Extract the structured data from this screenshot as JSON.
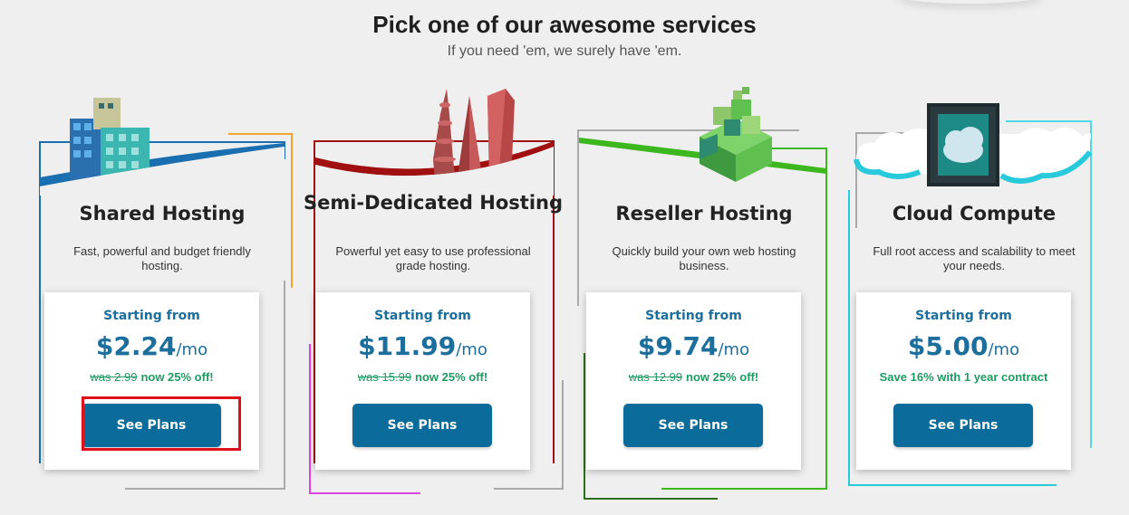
{
  "page": {
    "heading": "Pick one of our awesome services",
    "subheading": "If you need 'em, we surely have 'em."
  },
  "colors": {
    "accent": "#0b6b9a",
    "price": "#1c6e9c",
    "discount": "#1e9b62",
    "highlight": "#e0101a"
  },
  "services": [
    {
      "title": "Shared Hosting",
      "description": "Fast, powerful and budget friendly hosting.",
      "starting_label": "Starting from",
      "price": "$2.24",
      "per": "/mo",
      "was": "was 2.99",
      "deal": "now 25% off!",
      "button": "See Plans",
      "icon": "office-buildings-icon",
      "frame_color": "#1a6fb0"
    },
    {
      "title": "Semi-Dedicated Hosting",
      "description": "Powerful yet easy to use professional grade hosting.",
      "starting_label": "Starting from",
      "price": "$11.99",
      "per": "/mo",
      "was": "was 15.99",
      "deal": "now 25% off!",
      "button": "See Plans",
      "icon": "towers-icon",
      "frame_color": "#b01a1a"
    },
    {
      "title": "Reseller Hosting",
      "description": "Quickly build your own web hosting business.",
      "starting_label": "Starting from",
      "price": "$9.74",
      "per": "/mo",
      "was": "was 12.99",
      "deal": "now 25% off!",
      "button": "See Plans",
      "icon": "green-blocks-icon",
      "frame_color": "#3cb81e"
    },
    {
      "title": "Cloud Compute",
      "description": "Full root access and scalability to meet your needs.",
      "starting_label": "Starting from",
      "price": "$5.00",
      "per": "/mo",
      "was": "",
      "deal": "Save 16% with 1 year contract",
      "button": "See Plans",
      "icon": "cloud-chip-icon",
      "frame_color": "#29c9dc"
    }
  ]
}
